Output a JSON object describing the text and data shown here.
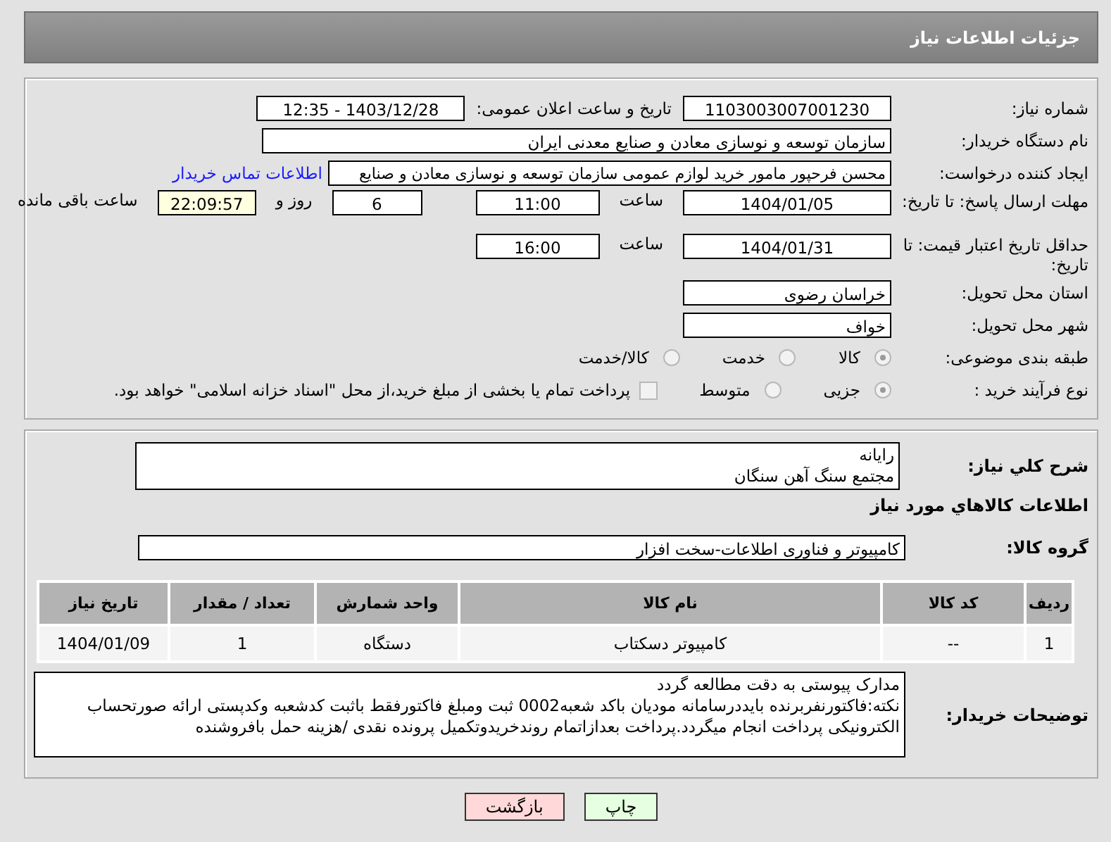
{
  "header": {
    "title": "جزئیات اطلاعات نیاز"
  },
  "need_number": {
    "label": "شماره نیاز:",
    "value": "1103003007001230"
  },
  "announce": {
    "label": "تاریخ و ساعت اعلان عمومی:",
    "value": "1403/12/28 - 12:35"
  },
  "buyer": {
    "label": "نام دستگاه خریدار:",
    "value": "سازمان توسعه و نوسازی معادن و صنایع معدنی ایران"
  },
  "requester": {
    "label": "ایجاد کننده درخواست:",
    "value": "محسن فرحپور مامور خرید لوازم عمومی سازمان توسعه و نوسازی معادن و صنایع",
    "link": "اطلاعات تماس خریدار"
  },
  "deadline": {
    "label": "مهلت ارسال پاسخ: تا تاریخ:",
    "date": "1404/01/05",
    "time_label": "ساعت",
    "time": "11:00",
    "days": "6",
    "days_label": "روز و",
    "remaining": "22:09:57",
    "remaining_label": "ساعت باقی مانده"
  },
  "validity": {
    "label": "حداقل تاریخ اعتبار قیمت: تا تاریخ:",
    "date": "1404/01/31",
    "time_label": "ساعت",
    "time": "16:00"
  },
  "province": {
    "label": "استان محل تحویل:",
    "value": "خراسان رضوی"
  },
  "city": {
    "label": "شهر محل تحویل:",
    "value": "خواف"
  },
  "category": {
    "label": "طبقه بندی موضوعی:",
    "options": [
      {
        "label": "کالا",
        "selected": true
      },
      {
        "label": "خدمت",
        "selected": false
      },
      {
        "label": "کالا/خدمت",
        "selected": false
      }
    ]
  },
  "process": {
    "label": "نوع فرآیند خرید :",
    "options": [
      {
        "label": "جزیی",
        "selected": true
      },
      {
        "label": "متوسط",
        "selected": false
      }
    ],
    "treasury": {
      "checked": false,
      "text": "پرداخت تمام یا بخشی از مبلغ خرید،از محل \"اسناد خزانه اسلامی\" خواهد بود."
    }
  },
  "description": {
    "label": "شرح کلي نیاز:",
    "value": "رایانه\nمجتمع سنگ آهن سنگان"
  },
  "goods_heading": "اطلاعات کالاهاي مورد نیاز",
  "goods_group": {
    "label": "گروه کالا:",
    "value": "کامپیوتر و فناوری اطلاعات-سخت افزار"
  },
  "table": {
    "columns": [
      "ردیف",
      "کد کالا",
      "نام کالا",
      "واحد شمارش",
      "تعداد / مقدار",
      "تاریخ نیاز"
    ],
    "rows": [
      [
        "1",
        "--",
        "کامپیوتر دسکتاب",
        "دستگاه",
        "1",
        "1404/01/09"
      ]
    ]
  },
  "notes": {
    "label": "توضیحات خریدار:",
    "value": "مدارک پیوستی به دقت مطالعه گردد\nنکته:فاکتورنفربرنده بایددرسامانه مودیان باکد شعبه0002 ثبت ومبلغ فاکتورفقط باثبت کدشعبه وکدپستی ارائه صورتحساب الکترونیکی پرداخت انجام میگردد.پرداخت بعدازاتمام روندخریدوتکمیل پرونده نقدی /هزینه حمل بافروشنده"
  },
  "buttons": [
    {
      "label": "چاپ",
      "kind": "print"
    },
    {
      "label": "بازگشت",
      "kind": "back"
    }
  ]
}
